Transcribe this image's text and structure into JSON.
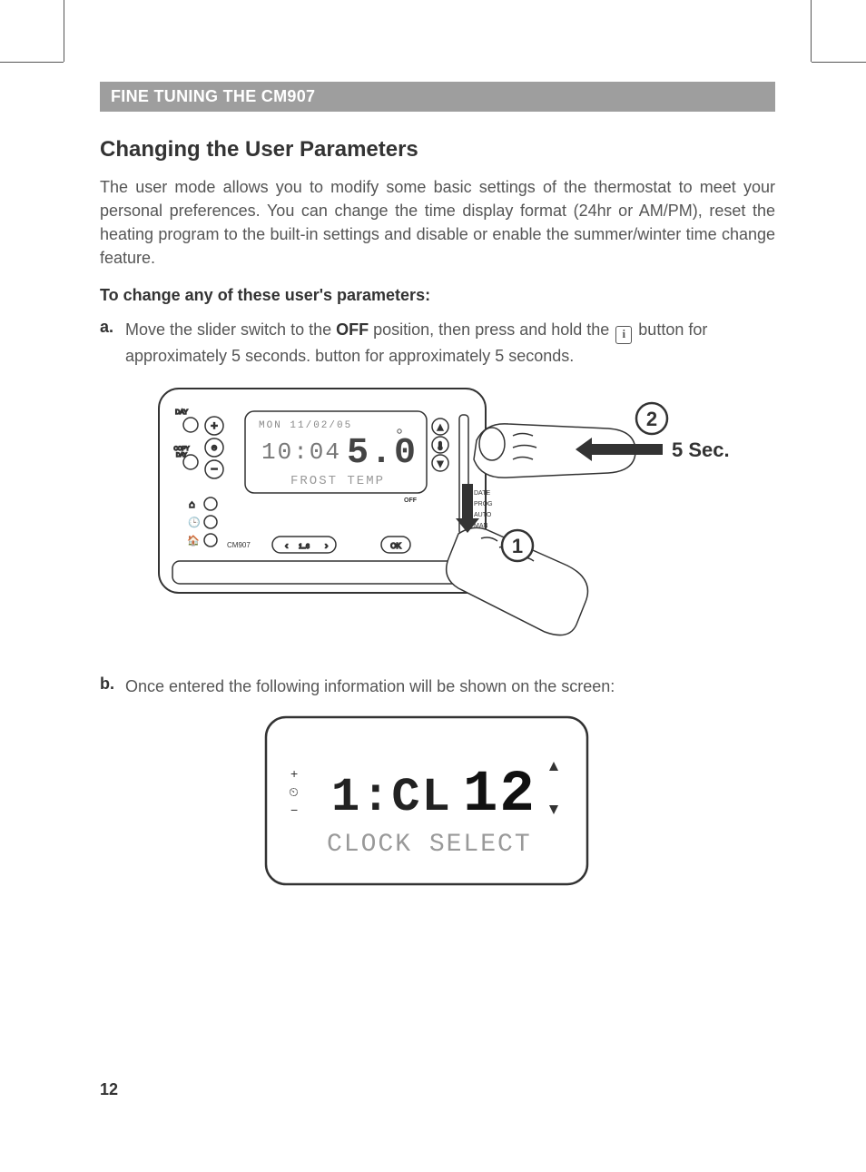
{
  "section_bar": "FINE TUNING THE CM907",
  "title": "Changing the User Parameters",
  "intro": "The user mode allows you to modify some basic settings of the thermostat to meet your personal preferences. You can change the time display format (24hr or AM/PM), reset the heating program to the built-in settings and disable or enable the summer/winter time change feature.",
  "subhead": "To change any of these user's parameters:",
  "step_a": {
    "marker": "a.",
    "text_pre": "Move the slider switch to the ",
    "off_word": "OFF",
    "text_mid": " position, then press and hold the ",
    "text_post": " button for approximately 5 seconds. button for approximately 5 seconds."
  },
  "fig1": {
    "callout1": "1",
    "callout2": "2",
    "duration": "5 Sec.",
    "lcd": {
      "top": "MON 11/02/05",
      "time": "10:04",
      "temp": "5.0",
      "bottom": "FROST TEMP",
      "mode": "OFF"
    },
    "side_labels": [
      "DATE",
      "PROG",
      "AUTO",
      "MAN",
      "OFF"
    ],
    "left_labels": {
      "day": "DAY",
      "copyday": "COPY\nDAY"
    },
    "model": "CM907",
    "prog_range": "1..6",
    "ok": "OK"
  },
  "step_b": {
    "marker": "b.",
    "text": "Once entered the following information will be shown on the screen:"
  },
  "fig2": {
    "left_code": "1:CL",
    "value": "12",
    "bottom": "CLOCK SELECT"
  },
  "page_number": "12"
}
